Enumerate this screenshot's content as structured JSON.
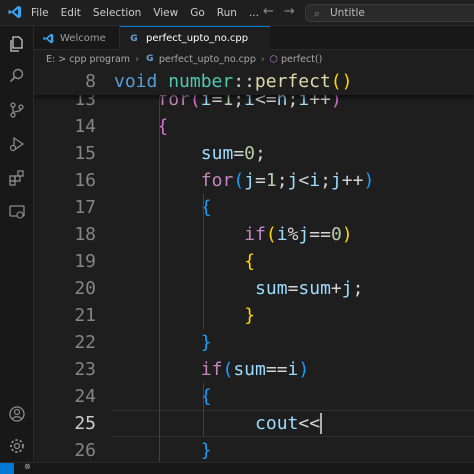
{
  "titlebar": {
    "menu": [
      "File",
      "Edit",
      "Selection",
      "View",
      "Go",
      "Run",
      "..."
    ],
    "command_center": "Untitle"
  },
  "tabs": [
    {
      "label": "Welcome"
    },
    {
      "label": "perfect_upto_no.cpp",
      "icon_text": "G"
    }
  ],
  "breadcrumb": {
    "parts": [
      "E: > cpp program",
      "perfect_upto_no.cpp",
      "perfect()"
    ]
  },
  "editor": {
    "sticky_line": {
      "number": "8",
      "tokens": [
        {
          "t": "void",
          "c": "kw"
        },
        {
          "t": " ",
          "c": "op"
        },
        {
          "t": "number",
          "c": "ns"
        },
        {
          "t": "::",
          "c": "op"
        },
        {
          "t": "perfect",
          "c": "fn"
        },
        {
          "t": "()",
          "c": "b3"
        }
      ]
    },
    "current_line": "25",
    "lines": [
      {
        "n": "13",
        "indent": 1,
        "tokens": [
          {
            "t": "for",
            "c": "ctl"
          },
          {
            "t": "(",
            "c": "b1"
          },
          {
            "t": "i",
            "c": "vr"
          },
          {
            "t": "=",
            "c": "op"
          },
          {
            "t": "1",
            "c": "nm"
          },
          {
            "t": ";",
            "c": "op"
          },
          {
            "t": "i",
            "c": "vr"
          },
          {
            "t": "<=",
            "c": "op"
          },
          {
            "t": "n",
            "c": "vr"
          },
          {
            "t": ";",
            "c": "op"
          },
          {
            "t": "i",
            "c": "vr"
          },
          {
            "t": "++",
            "c": "op"
          },
          {
            "t": ")",
            "c": "b1"
          }
        ]
      },
      {
        "n": "14",
        "indent": 1,
        "tokens": [
          {
            "t": "{",
            "c": "b1"
          }
        ]
      },
      {
        "n": "15",
        "indent": 2,
        "tokens": [
          {
            "t": "sum",
            "c": "vr"
          },
          {
            "t": "=",
            "c": "op"
          },
          {
            "t": "0",
            "c": "nm"
          },
          {
            "t": ";",
            "c": "op"
          }
        ]
      },
      {
        "n": "16",
        "indent": 2,
        "tokens": [
          {
            "t": "for",
            "c": "ctl"
          },
          {
            "t": "(",
            "c": "b2"
          },
          {
            "t": "j",
            "c": "vr"
          },
          {
            "t": "=",
            "c": "op"
          },
          {
            "t": "1",
            "c": "nm"
          },
          {
            "t": ";",
            "c": "op"
          },
          {
            "t": "j",
            "c": "vr"
          },
          {
            "t": "<",
            "c": "op"
          },
          {
            "t": "i",
            "c": "vr"
          },
          {
            "t": ";",
            "c": "op"
          },
          {
            "t": "j",
            "c": "vr"
          },
          {
            "t": "++",
            "c": "op"
          },
          {
            "t": ")",
            "c": "b2"
          }
        ]
      },
      {
        "n": "17",
        "indent": 2,
        "tokens": [
          {
            "t": "{",
            "c": "b2"
          }
        ]
      },
      {
        "n": "18",
        "indent": 3,
        "tokens": [
          {
            "t": "if",
            "c": "ctl"
          },
          {
            "t": "(",
            "c": "b3"
          },
          {
            "t": "i",
            "c": "vr"
          },
          {
            "t": "%",
            "c": "op"
          },
          {
            "t": "j",
            "c": "vr"
          },
          {
            "t": "==",
            "c": "op"
          },
          {
            "t": "0",
            "c": "nm"
          },
          {
            "t": ")",
            "c": "b3"
          }
        ]
      },
      {
        "n": "19",
        "indent": 3,
        "tokens": [
          {
            "t": "{",
            "c": "b3"
          }
        ]
      },
      {
        "n": "20",
        "indent": 3,
        "extra": 1,
        "tokens": [
          {
            "t": "sum",
            "c": "vr"
          },
          {
            "t": "=",
            "c": "op"
          },
          {
            "t": "sum",
            "c": "vr"
          },
          {
            "t": "+",
            "c": "op"
          },
          {
            "t": "j",
            "c": "vr"
          },
          {
            "t": ";",
            "c": "op"
          }
        ]
      },
      {
        "n": "21",
        "indent": 3,
        "tokens": [
          {
            "t": "}",
            "c": "b3"
          }
        ]
      },
      {
        "n": "22",
        "indent": 2,
        "tokens": [
          {
            "t": "}",
            "c": "b2"
          }
        ]
      },
      {
        "n": "23",
        "indent": 2,
        "tokens": [
          {
            "t": "if",
            "c": "ctl"
          },
          {
            "t": "(",
            "c": "b2"
          },
          {
            "t": "sum",
            "c": "vr"
          },
          {
            "t": "==",
            "c": "op"
          },
          {
            "t": "i",
            "c": "vr"
          },
          {
            "t": ")",
            "c": "b2"
          }
        ]
      },
      {
        "n": "24",
        "indent": 2,
        "tokens": [
          {
            "t": "{",
            "c": "b2"
          }
        ]
      },
      {
        "n": "25",
        "indent": 3,
        "extra": 1,
        "tokens": [
          {
            "t": "cout",
            "c": "vr"
          },
          {
            "t": "<<",
            "c": "op"
          }
        ]
      },
      {
        "n": "26",
        "indent": 2,
        "tokens": [
          {
            "t": "}",
            "c": "b2"
          }
        ]
      }
    ]
  },
  "colors": {
    "accent": "#0078d4",
    "editor_bg": "#1e1e1e",
    "keyword": "#569cd6",
    "control": "#c586c0",
    "function": "#dcdcaa",
    "variable": "#9cdcfe",
    "number": "#b5cea8"
  },
  "icons": [
    "vscode-logo-icon",
    "explorer-icon",
    "search-icon",
    "source-control-icon",
    "run-debug-icon",
    "extensions-icon",
    "remote-explorer-icon",
    "account-icon",
    "settings-gear-icon",
    "back-arrow-icon",
    "forward-arrow-icon",
    "search-icon",
    "cpp-file-icon",
    "cube-icon"
  ]
}
